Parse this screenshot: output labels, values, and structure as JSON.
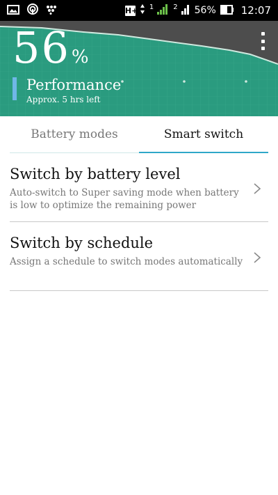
{
  "status_bar": {
    "network_type": "H+",
    "sim1_label": "1",
    "sim2_label": "2",
    "battery_percent": "56%",
    "time": "12:07",
    "icons": [
      "image-icon",
      "hotspot-icon",
      "blackberry-icon",
      "signal-icon",
      "battery-icon"
    ]
  },
  "header": {
    "battery_value": "56",
    "percent_sign": "%",
    "mode_title": "Performance",
    "mode_subtitle": "Approx. 5 hrs left",
    "colors": {
      "graph_fill": "#2a9b7f",
      "graph_line": "#cfe9df",
      "mode_accent": "#6fb7e8",
      "background": "#4d4d4d"
    }
  },
  "tabs": [
    {
      "label": "Battery modes",
      "active": false
    },
    {
      "label": "Smart switch",
      "active": true
    }
  ],
  "list": [
    {
      "title": "Switch by battery level",
      "description": "Auto-switch to Super saving mode when battery is low to optimize the remaining power"
    },
    {
      "title": "Switch by schedule",
      "description": "Assign a schedule to switch modes automatically"
    }
  ],
  "accent_color": "#2fa7c8"
}
